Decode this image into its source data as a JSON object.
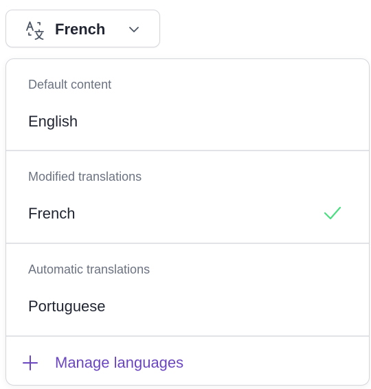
{
  "trigger": {
    "icon": "translate-icon",
    "label": "French",
    "chevron": "chevron-down-icon"
  },
  "menu": {
    "sections": [
      {
        "label": "Default content",
        "options": [
          {
            "label": "English",
            "selected": false
          }
        ]
      },
      {
        "label": "Modified translations",
        "options": [
          {
            "label": "French",
            "selected": true
          }
        ]
      },
      {
        "label": "Automatic translations",
        "options": [
          {
            "label": "Portuguese",
            "selected": false
          }
        ]
      }
    ],
    "manage": {
      "icon": "plus-icon",
      "label": "Manage languages"
    }
  },
  "colors": {
    "accent": "#6b46c1",
    "check": "#4ade80",
    "muted_text": "#6b7280",
    "border": "#d4d6dc"
  }
}
